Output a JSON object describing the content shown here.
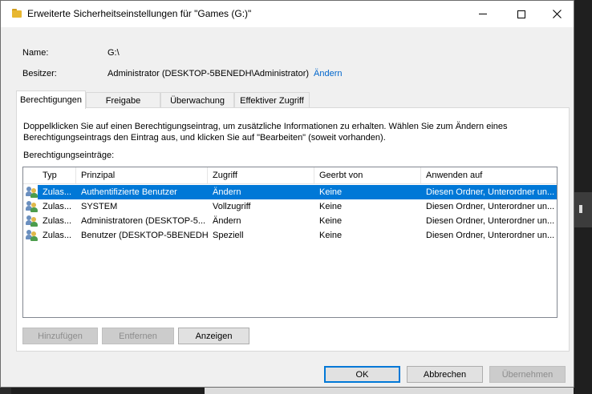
{
  "window": {
    "title": "Erweiterte Sicherheitseinstellungen für \"Games (G:)\""
  },
  "info": {
    "name_label": "Name:",
    "name_value": "G:\\",
    "owner_label": "Besitzer:",
    "owner_value": "Administrator (DESKTOP-5BENEDH\\Administrator)",
    "change_owner_link": "Ändern"
  },
  "tabs": [
    {
      "label": "Berechtigungen",
      "active": true
    },
    {
      "label": "Freigabe"
    },
    {
      "label": "Überwachung"
    },
    {
      "label": "Effektiver Zugriff"
    }
  ],
  "permissions": {
    "description": "Doppelklicken Sie auf einen Berechtigungseintrag, um zusätzliche Informationen zu erhalten. Wählen Sie zum Ändern eines Berechtigungseintrags den Eintrag aus, und klicken Sie auf \"Bearbeiten\" (soweit vorhanden).",
    "entries_label": "Berechtigungseinträge:",
    "columns": [
      "Typ",
      "Prinzipal",
      "Zugriff",
      "Geerbt von",
      "Anwenden auf"
    ],
    "rows": [
      {
        "type": "Zulas...",
        "principal": "Authentifizierte Benutzer",
        "access": "Ändern",
        "inherited": "Keine",
        "applies": "Diesen Ordner, Unterordner un...",
        "selected": true
      },
      {
        "type": "Zulas...",
        "principal": "SYSTEM",
        "access": "Vollzugriff",
        "inherited": "Keine",
        "applies": "Diesen Ordner, Unterordner un..."
      },
      {
        "type": "Zulas...",
        "principal": "Administratoren (DESKTOP-5...",
        "access": "Ändern",
        "inherited": "Keine",
        "applies": "Diesen Ordner, Unterordner un..."
      },
      {
        "type": "Zulas...",
        "principal": "Benutzer (DESKTOP-5BENEDH...",
        "access": "Speziell",
        "inherited": "Keine",
        "applies": "Diesen Ordner, Unterordner un..."
      }
    ],
    "add_button": "Hinzufügen",
    "remove_button": "Entfernen",
    "view_button": "Anzeigen"
  },
  "footer": {
    "ok": "OK",
    "cancel": "Abbrechen",
    "apply": "Übernehmen"
  },
  "icons": {
    "title": "folder-icon",
    "row": "users-icon"
  },
  "colors": {
    "selection": "#0078d7",
    "link": "#0066cc"
  }
}
